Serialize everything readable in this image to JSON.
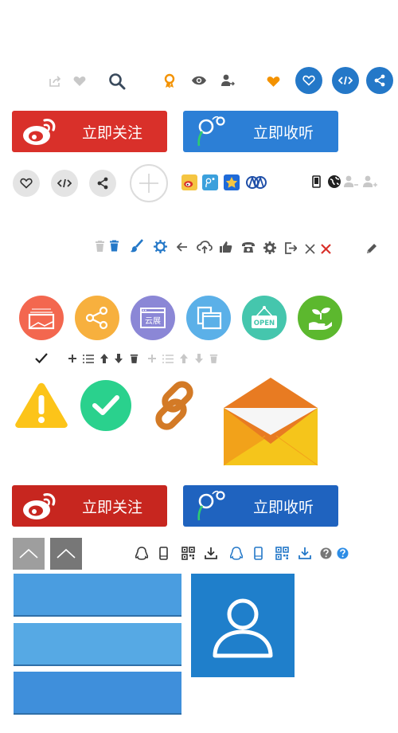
{
  "buttons": {
    "follow_label": "立即关注",
    "listen_label": "立即收听"
  },
  "badges": {
    "open_sign": "OPEN",
    "cloud_label": "云展"
  },
  "colors": {
    "weibo_red": "#d9302a",
    "weibo_red_dark": "#c7261f",
    "qq_blue": "#2c7fd6",
    "qq_blue_dark": "#1f63bf",
    "primary_blue": "#2478c8",
    "orange": "#f39200",
    "gray_icon": "#c8c8c8",
    "dark_icon": "#555555",
    "tile_blue": "#4a9de0"
  },
  "icons": {
    "row1": [
      "share-out-icon",
      "heart-icon",
      "search-icon",
      "award-icon",
      "eye-icon",
      "user-follow-icon",
      "heart-filled-icon",
      "heart-circle-icon",
      "code-circle-icon",
      "share-circle-icon"
    ],
    "row2": [
      "heart-icon",
      "code-icon",
      "share-icon",
      "plus-icon",
      "weibo-icon",
      "tencent-weibo-icon",
      "star-icon",
      "renren-icon",
      "mobile-icon",
      "globe-icon",
      "user-add-icon"
    ],
    "toolbar": [
      "trash-icon",
      "brush-icon",
      "gear-icon",
      "arrow-left-icon",
      "cloud-upload-icon",
      "thumbs-up-icon",
      "phone-icon",
      "logout-icon",
      "close-icon",
      "pencil-icon"
    ],
    "circles": [
      "picture-icon",
      "share-icon",
      "cloud-display-icon",
      "window-icon",
      "open-sign-icon",
      "plant-hand-icon"
    ],
    "small_row": [
      "check-icon",
      "plus-icon",
      "list-icon",
      "arrow-up-icon",
      "arrow-down-icon",
      "trash-icon"
    ],
    "big": [
      "warning-icon",
      "check-circle-icon",
      "link-icon",
      "envelope-icon"
    ],
    "bottom_row": [
      "qq-icon",
      "mobile-icon",
      "qrcode-icon",
      "download-icon",
      "help-icon"
    ],
    "tiles": [
      "chevron-up-icon",
      "user-icon"
    ]
  }
}
